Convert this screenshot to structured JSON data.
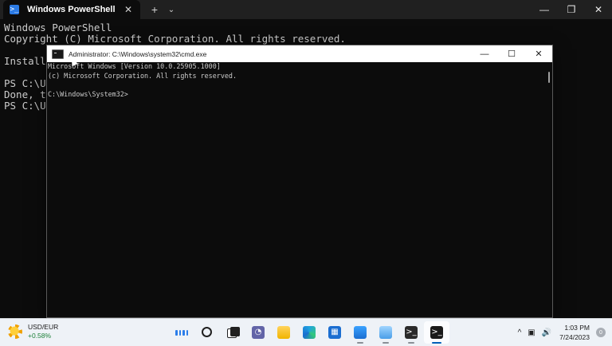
{
  "powershell": {
    "tab_icon_glyph": ">_",
    "tab_title": "Windows PowerShell",
    "tab_close_glyph": "✕",
    "new_tab_glyph": "+",
    "dropdown_glyph": "⌄",
    "controls": {
      "minimize": "—",
      "maximize": "❐",
      "close": "✕"
    },
    "lines": [
      "Windows PowerShell",
      "Copyright (C) Microsoft Corporation. All rights reserved.",
      "",
      "Install",
      "",
      "PS C:\\Us",
      "Done, ta",
      "PS C:\\Us"
    ]
  },
  "cmd": {
    "title": "Administrator: C:\\Windows\\system32\\cmd.exe",
    "controls": {
      "minimize": "—",
      "maximize": "☐",
      "close": "✕"
    },
    "lines": [
      "Microsoft Windows [Version 10.0.25905.1000]",
      "(c) Microsoft Corporation. All rights reserved.",
      "",
      "C:\\Windows\\System32>"
    ]
  },
  "taskbar": {
    "widget": {
      "title": "USD/EUR",
      "change": "+0.58%"
    },
    "apps": [
      {
        "name": "start",
        "glyph": ""
      },
      {
        "name": "search",
        "glyph": ""
      },
      {
        "name": "task-view",
        "glyph": ""
      },
      {
        "name": "chat",
        "glyph": "◔"
      },
      {
        "name": "file-explorer",
        "glyph": ""
      },
      {
        "name": "edge",
        "glyph": ""
      },
      {
        "name": "store",
        "glyph": "▦"
      },
      {
        "name": "photos",
        "glyph": ""
      },
      {
        "name": "snipping",
        "glyph": ""
      },
      {
        "name": "terminal",
        "glyph": ">_"
      },
      {
        "name": "cmd",
        "glyph": ">_"
      }
    ],
    "tray": {
      "chevron": "^",
      "network": "▣",
      "volume": "🔊",
      "time": "1:03 PM",
      "date": "7/24/2023",
      "notifications": "0"
    }
  }
}
